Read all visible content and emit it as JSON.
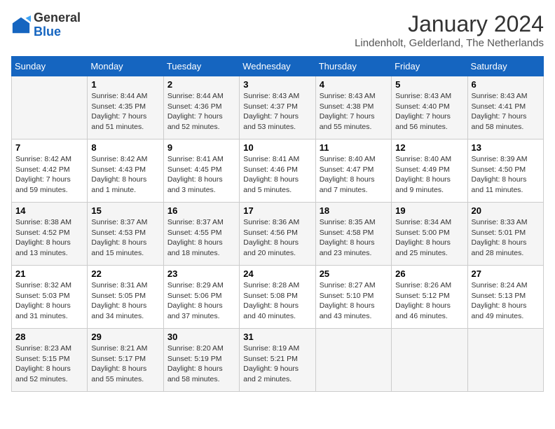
{
  "logo": {
    "general": "General",
    "blue": "Blue"
  },
  "header": {
    "title": "January 2024",
    "subtitle": "Lindenholt, Gelderland, The Netherlands"
  },
  "weekdays": [
    "Sunday",
    "Monday",
    "Tuesday",
    "Wednesday",
    "Thursday",
    "Friday",
    "Saturday"
  ],
  "weeks": [
    [
      {
        "day": "",
        "sunrise": "",
        "sunset": "",
        "daylight": ""
      },
      {
        "day": "1",
        "sunrise": "Sunrise: 8:44 AM",
        "sunset": "Sunset: 4:35 PM",
        "daylight": "Daylight: 7 hours and 51 minutes."
      },
      {
        "day": "2",
        "sunrise": "Sunrise: 8:44 AM",
        "sunset": "Sunset: 4:36 PM",
        "daylight": "Daylight: 7 hours and 52 minutes."
      },
      {
        "day": "3",
        "sunrise": "Sunrise: 8:43 AM",
        "sunset": "Sunset: 4:37 PM",
        "daylight": "Daylight: 7 hours and 53 minutes."
      },
      {
        "day": "4",
        "sunrise": "Sunrise: 8:43 AM",
        "sunset": "Sunset: 4:38 PM",
        "daylight": "Daylight: 7 hours and 55 minutes."
      },
      {
        "day": "5",
        "sunrise": "Sunrise: 8:43 AM",
        "sunset": "Sunset: 4:40 PM",
        "daylight": "Daylight: 7 hours and 56 minutes."
      },
      {
        "day": "6",
        "sunrise": "Sunrise: 8:43 AM",
        "sunset": "Sunset: 4:41 PM",
        "daylight": "Daylight: 7 hours and 58 minutes."
      }
    ],
    [
      {
        "day": "7",
        "sunrise": "Sunrise: 8:42 AM",
        "sunset": "Sunset: 4:42 PM",
        "daylight": "Daylight: 7 hours and 59 minutes."
      },
      {
        "day": "8",
        "sunrise": "Sunrise: 8:42 AM",
        "sunset": "Sunset: 4:43 PM",
        "daylight": "Daylight: 8 hours and 1 minute."
      },
      {
        "day": "9",
        "sunrise": "Sunrise: 8:41 AM",
        "sunset": "Sunset: 4:45 PM",
        "daylight": "Daylight: 8 hours and 3 minutes."
      },
      {
        "day": "10",
        "sunrise": "Sunrise: 8:41 AM",
        "sunset": "Sunset: 4:46 PM",
        "daylight": "Daylight: 8 hours and 5 minutes."
      },
      {
        "day": "11",
        "sunrise": "Sunrise: 8:40 AM",
        "sunset": "Sunset: 4:47 PM",
        "daylight": "Daylight: 8 hours and 7 minutes."
      },
      {
        "day": "12",
        "sunrise": "Sunrise: 8:40 AM",
        "sunset": "Sunset: 4:49 PM",
        "daylight": "Daylight: 8 hours and 9 minutes."
      },
      {
        "day": "13",
        "sunrise": "Sunrise: 8:39 AM",
        "sunset": "Sunset: 4:50 PM",
        "daylight": "Daylight: 8 hours and 11 minutes."
      }
    ],
    [
      {
        "day": "14",
        "sunrise": "Sunrise: 8:38 AM",
        "sunset": "Sunset: 4:52 PM",
        "daylight": "Daylight: 8 hours and 13 minutes."
      },
      {
        "day": "15",
        "sunrise": "Sunrise: 8:37 AM",
        "sunset": "Sunset: 4:53 PM",
        "daylight": "Daylight: 8 hours and 15 minutes."
      },
      {
        "day": "16",
        "sunrise": "Sunrise: 8:37 AM",
        "sunset": "Sunset: 4:55 PM",
        "daylight": "Daylight: 8 hours and 18 minutes."
      },
      {
        "day": "17",
        "sunrise": "Sunrise: 8:36 AM",
        "sunset": "Sunset: 4:56 PM",
        "daylight": "Daylight: 8 hours and 20 minutes."
      },
      {
        "day": "18",
        "sunrise": "Sunrise: 8:35 AM",
        "sunset": "Sunset: 4:58 PM",
        "daylight": "Daylight: 8 hours and 23 minutes."
      },
      {
        "day": "19",
        "sunrise": "Sunrise: 8:34 AM",
        "sunset": "Sunset: 5:00 PM",
        "daylight": "Daylight: 8 hours and 25 minutes."
      },
      {
        "day": "20",
        "sunrise": "Sunrise: 8:33 AM",
        "sunset": "Sunset: 5:01 PM",
        "daylight": "Daylight: 8 hours and 28 minutes."
      }
    ],
    [
      {
        "day": "21",
        "sunrise": "Sunrise: 8:32 AM",
        "sunset": "Sunset: 5:03 PM",
        "daylight": "Daylight: 8 hours and 31 minutes."
      },
      {
        "day": "22",
        "sunrise": "Sunrise: 8:31 AM",
        "sunset": "Sunset: 5:05 PM",
        "daylight": "Daylight: 8 hours and 34 minutes."
      },
      {
        "day": "23",
        "sunrise": "Sunrise: 8:29 AM",
        "sunset": "Sunset: 5:06 PM",
        "daylight": "Daylight: 8 hours and 37 minutes."
      },
      {
        "day": "24",
        "sunrise": "Sunrise: 8:28 AM",
        "sunset": "Sunset: 5:08 PM",
        "daylight": "Daylight: 8 hours and 40 minutes."
      },
      {
        "day": "25",
        "sunrise": "Sunrise: 8:27 AM",
        "sunset": "Sunset: 5:10 PM",
        "daylight": "Daylight: 8 hours and 43 minutes."
      },
      {
        "day": "26",
        "sunrise": "Sunrise: 8:26 AM",
        "sunset": "Sunset: 5:12 PM",
        "daylight": "Daylight: 8 hours and 46 minutes."
      },
      {
        "day": "27",
        "sunrise": "Sunrise: 8:24 AM",
        "sunset": "Sunset: 5:13 PM",
        "daylight": "Daylight: 8 hours and 49 minutes."
      }
    ],
    [
      {
        "day": "28",
        "sunrise": "Sunrise: 8:23 AM",
        "sunset": "Sunset: 5:15 PM",
        "daylight": "Daylight: 8 hours and 52 minutes."
      },
      {
        "day": "29",
        "sunrise": "Sunrise: 8:21 AM",
        "sunset": "Sunset: 5:17 PM",
        "daylight": "Daylight: 8 hours and 55 minutes."
      },
      {
        "day": "30",
        "sunrise": "Sunrise: 8:20 AM",
        "sunset": "Sunset: 5:19 PM",
        "daylight": "Daylight: 8 hours and 58 minutes."
      },
      {
        "day": "31",
        "sunrise": "Sunrise: 8:19 AM",
        "sunset": "Sunset: 5:21 PM",
        "daylight": "Daylight: 9 hours and 2 minutes."
      },
      {
        "day": "",
        "sunrise": "",
        "sunset": "",
        "daylight": ""
      },
      {
        "day": "",
        "sunrise": "",
        "sunset": "",
        "daylight": ""
      },
      {
        "day": "",
        "sunrise": "",
        "sunset": "",
        "daylight": ""
      }
    ]
  ]
}
